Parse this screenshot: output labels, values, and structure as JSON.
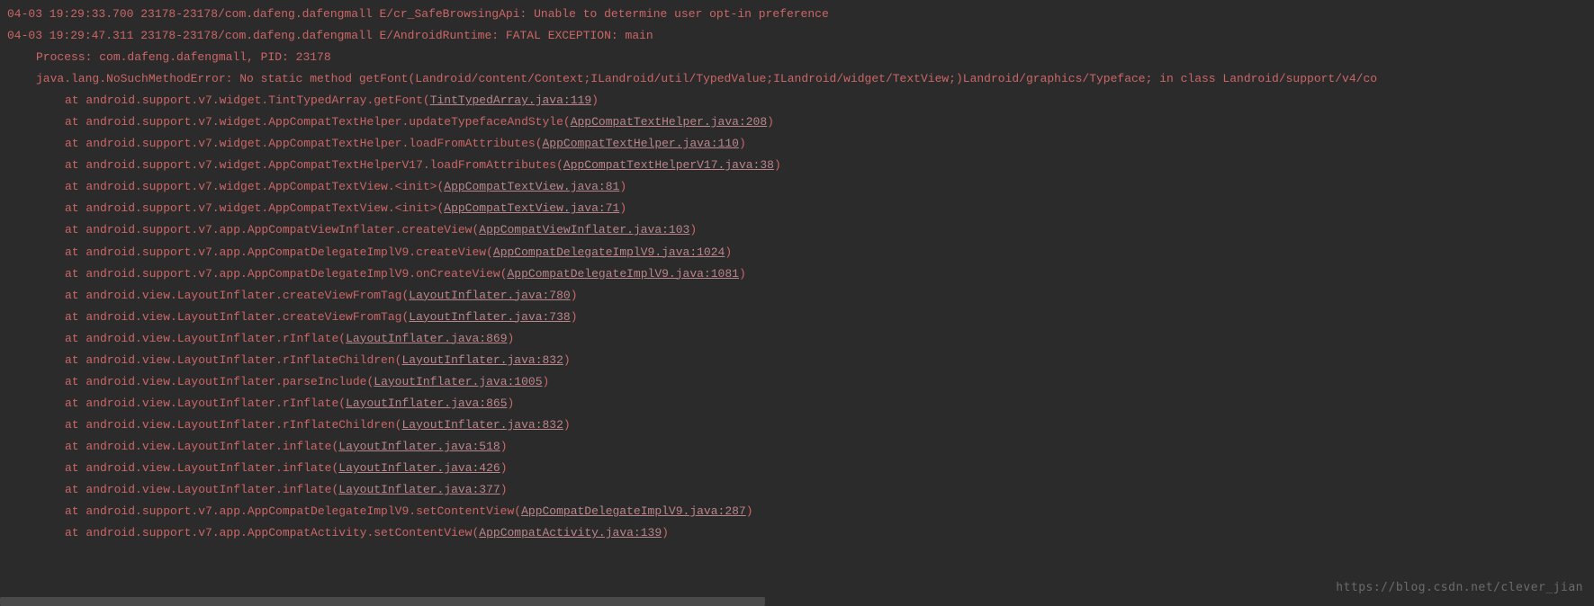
{
  "lines": [
    {
      "type": "header",
      "text": "04-03 19:29:33.700 23178-23178/com.dafeng.dafengmall E/cr_SafeBrowsingApi: Unable to determine user opt-in preference"
    },
    {
      "type": "header",
      "text": "04-03 19:29:47.311 23178-23178/com.dafeng.dafengmall E/AndroidRuntime: FATAL EXCEPTION: main"
    },
    {
      "type": "indent1",
      "text": "Process: com.dafeng.dafengmall, PID: 23178"
    },
    {
      "type": "indent1",
      "text": "java.lang.NoSuchMethodError: No static method getFont(Landroid/content/Context;ILandroid/util/TypedValue;ILandroid/widget/TextView;)Landroid/graphics/Typeface; in class Landroid/support/v4/co"
    },
    {
      "type": "trace",
      "prefix": "at android.support.v7.widget.TintTypedArray.getFont",
      "open": "(",
      "link": "TintTypedArray.java:119",
      "close": ")"
    },
    {
      "type": "trace",
      "prefix": "at android.support.v7.widget.AppCompatTextHelper.updateTypefaceAndStyle",
      "open": "(",
      "link": "AppCompatTextHelper.java:208",
      "close": ")"
    },
    {
      "type": "trace",
      "prefix": "at android.support.v7.widget.AppCompatTextHelper.loadFromAttributes",
      "open": "(",
      "link": "AppCompatTextHelper.java:110",
      "close": ")"
    },
    {
      "type": "trace",
      "prefix": "at android.support.v7.widget.AppCompatTextHelperV17.loadFromAttributes",
      "open": "(",
      "link": "AppCompatTextHelperV17.java:38",
      "close": ")"
    },
    {
      "type": "trace",
      "prefix": "at android.support.v7.widget.AppCompatTextView.<init>",
      "open": "(",
      "link": "AppCompatTextView.java:81",
      "close": ")"
    },
    {
      "type": "trace",
      "prefix": "at android.support.v7.widget.AppCompatTextView.<init>",
      "open": "(",
      "link": "AppCompatTextView.java:71",
      "close": ")"
    },
    {
      "type": "trace",
      "prefix": "at android.support.v7.app.AppCompatViewInflater.createView",
      "open": "(",
      "link": "AppCompatViewInflater.java:103",
      "close": ")"
    },
    {
      "type": "trace",
      "prefix": "at android.support.v7.app.AppCompatDelegateImplV9.createView",
      "open": "(",
      "link": "AppCompatDelegateImplV9.java:1024",
      "close": ")"
    },
    {
      "type": "trace",
      "prefix": "at android.support.v7.app.AppCompatDelegateImplV9.onCreateView",
      "open": "(",
      "link": "AppCompatDelegateImplV9.java:1081",
      "close": ")"
    },
    {
      "type": "trace",
      "prefix": "at android.view.LayoutInflater.createViewFromTag",
      "open": "(",
      "link": "LayoutInflater.java:780",
      "close": ")"
    },
    {
      "type": "trace",
      "prefix": "at android.view.LayoutInflater.createViewFromTag",
      "open": "(",
      "link": "LayoutInflater.java:738",
      "close": ")"
    },
    {
      "type": "trace",
      "prefix": "at android.view.LayoutInflater.rInflate",
      "open": "(",
      "link": "LayoutInflater.java:869",
      "close": ")"
    },
    {
      "type": "trace",
      "prefix": "at android.view.LayoutInflater.rInflateChildren",
      "open": "(",
      "link": "LayoutInflater.java:832",
      "close": ")"
    },
    {
      "type": "trace",
      "prefix": "at android.view.LayoutInflater.parseInclude",
      "open": "(",
      "link": "LayoutInflater.java:1005",
      "close": ")"
    },
    {
      "type": "trace",
      "prefix": "at android.view.LayoutInflater.rInflate",
      "open": "(",
      "link": "LayoutInflater.java:865",
      "close": ")"
    },
    {
      "type": "trace",
      "prefix": "at android.view.LayoutInflater.rInflateChildren",
      "open": "(",
      "link": "LayoutInflater.java:832",
      "close": ")"
    },
    {
      "type": "trace",
      "prefix": "at android.view.LayoutInflater.inflate",
      "open": "(",
      "link": "LayoutInflater.java:518",
      "close": ")"
    },
    {
      "type": "trace",
      "prefix": "at android.view.LayoutInflater.inflate",
      "open": "(",
      "link": "LayoutInflater.java:426",
      "close": ")"
    },
    {
      "type": "trace",
      "prefix": "at android.view.LayoutInflater.inflate",
      "open": "(",
      "link": "LayoutInflater.java:377",
      "close": ")"
    },
    {
      "type": "trace",
      "prefix": "at android.support.v7.app.AppCompatDelegateImplV9.setContentView",
      "open": "(",
      "link": "AppCompatDelegateImplV9.java:287",
      "close": ")"
    },
    {
      "type": "trace",
      "prefix": "at android.support.v7.app.AppCompatActivity.setContentView",
      "open": "(",
      "link": "AppCompatActivity.java:139",
      "close": ")"
    }
  ],
  "watermark": "https://blog.csdn.net/clever_jian"
}
